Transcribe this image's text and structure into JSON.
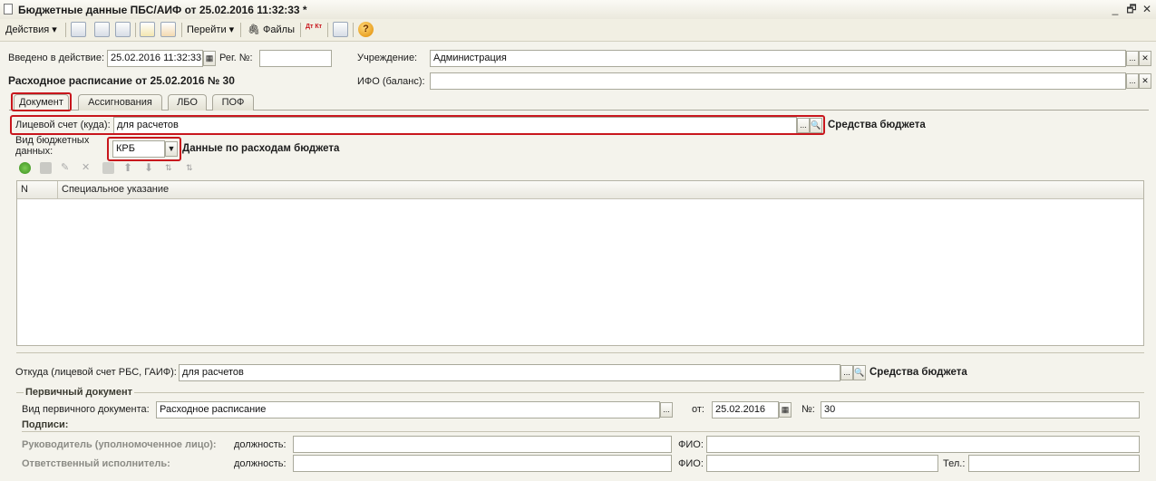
{
  "window": {
    "title": "Бюджетные данные ПБС/АИФ  от 25.02.2016 11:32:33 *",
    "controls": [
      "_",
      "🗗",
      "✕"
    ]
  },
  "toolbar": {
    "actions_label": "Действия",
    "goto_label": "Перейти",
    "files_label": "Файлы",
    "dtkt_label": "Дт Кт",
    "help_label": "?"
  },
  "header": {
    "effective_label": "Введено в действие:",
    "effective_value": "25.02.2016 11:32:33",
    "regnum_label": "Рег. №:",
    "regnum_value": "",
    "institution_label": "Учреждение:",
    "institution_value": "Администрация",
    "ifo_label": "ИФО (баланс):",
    "ifo_value": "",
    "doc_title": "Расходное расписание от 25.02.2016 № 30"
  },
  "tabs": [
    "Документ",
    "Ассигнования",
    "ЛБО",
    "ПОФ"
  ],
  "document": {
    "account_to_label": "Лицевой счет (куда):",
    "account_to_value": "для расчетов",
    "account_to_hint": "Средства бюджета",
    "budget_type_label": "Вид бюджетных данных:",
    "budget_type_value": "КРБ",
    "budget_type_hint": "Данные по расходам бюджета",
    "table_columns": [
      "N",
      "Специальное указание"
    ],
    "table_rows": []
  },
  "from": {
    "label": "Откуда (лицевой счет РБС, ГАИФ):",
    "value": "для расчетов",
    "hint": "Средства бюджета"
  },
  "primary_doc": {
    "group_title": "Первичный документ",
    "type_label": "Вид первичного документа:",
    "type_value": "Расходное расписание",
    "date_label": "от:",
    "date_value": "25.02.2016",
    "num_label": "№:",
    "num_value": "30"
  },
  "signatures": {
    "group_title": "Подписи:",
    "head_label": "Руководитель (уполномоченное лицо):",
    "executor_label": "Ответственный исполнитель:",
    "position_label": "должность:",
    "fio_label": "ФИО:",
    "phone_label": "Тел.:"
  },
  "colors": {
    "highlight": "#c8161d",
    "background": "#f4f3ec"
  }
}
